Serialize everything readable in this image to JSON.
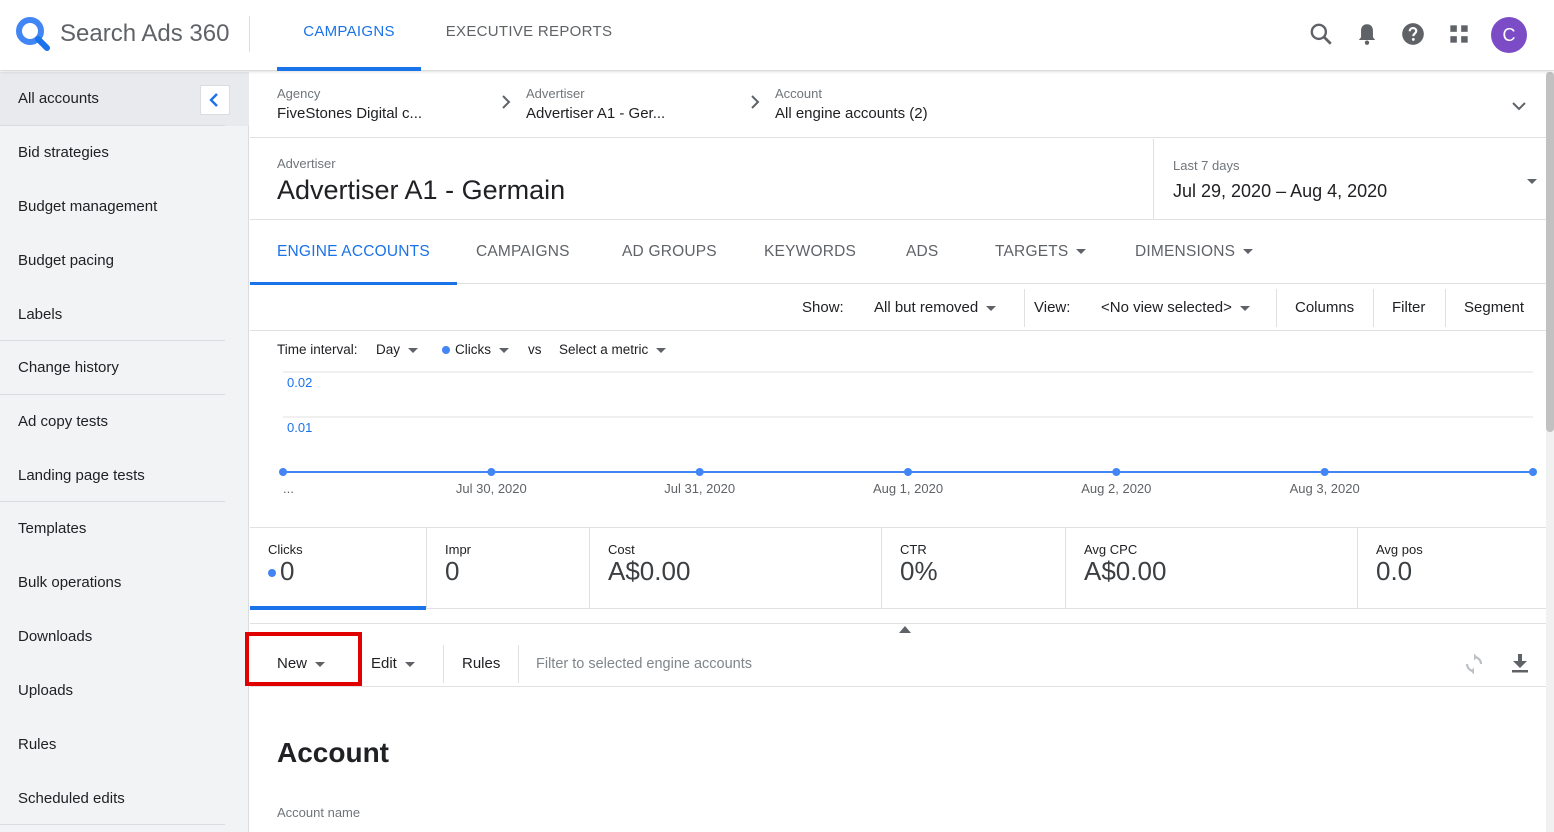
{
  "app": {
    "name": "Search Ads 360",
    "avatar_letter": "C"
  },
  "top_tabs": [
    {
      "label": "CAMPAIGNS",
      "active": true
    },
    {
      "label": "EXECUTIVE REPORTS",
      "active": false
    }
  ],
  "top_icons": [
    "search-icon",
    "notifications-icon",
    "help-icon",
    "apps-icon"
  ],
  "sidebar": {
    "items": [
      {
        "label": "All accounts"
      },
      {
        "label": "Bid strategies"
      },
      {
        "label": "Budget management"
      },
      {
        "label": "Budget pacing"
      },
      {
        "label": "Labels"
      },
      {
        "label": "Change history"
      },
      {
        "label": "Ad copy tests"
      },
      {
        "label": "Landing page tests"
      },
      {
        "label": "Templates"
      },
      {
        "label": "Bulk operations"
      },
      {
        "label": "Downloads"
      },
      {
        "label": "Uploads"
      },
      {
        "label": "Rules"
      },
      {
        "label": "Scheduled edits"
      }
    ]
  },
  "breadcrumb": [
    {
      "label": "Agency",
      "value": "FiveStones Digital c..."
    },
    {
      "label": "Advertiser",
      "value": "Advertiser A1 - Ger..."
    },
    {
      "label": "Account",
      "value": "All engine accounts (2)"
    }
  ],
  "header": {
    "label": "Advertiser",
    "title": "Advertiser A1 - Germain",
    "date_label": "Last 7 days",
    "date_range": "Jul 29, 2020 – Aug 4, 2020"
  },
  "entity_tabs": [
    {
      "label": "ENGINE ACCOUNTS",
      "active": true
    },
    {
      "label": "CAMPAIGNS"
    },
    {
      "label": "AD GROUPS"
    },
    {
      "label": "KEYWORDS"
    },
    {
      "label": "ADS"
    },
    {
      "label": "TARGETS"
    },
    {
      "label": "DIMENSIONS"
    }
  ],
  "toolbar": {
    "show_label": "Show:",
    "show_value": "All but removed",
    "view_label": "View:",
    "view_value": "<No view selected>",
    "columns": "Columns",
    "filter": "Filter",
    "segment": "Segment"
  },
  "chart_controls": {
    "interval_label": "Time interval:",
    "interval_value": "Day",
    "metric": "Clicks",
    "vs": "vs",
    "compare": "Select a metric"
  },
  "chart_data": {
    "type": "line",
    "x": [
      "...",
      "Jul 30, 2020",
      "Jul 31, 2020",
      "Aug 1, 2020",
      "Aug 2, 2020",
      "Aug 3, 2020",
      ""
    ],
    "series": [
      {
        "name": "Clicks",
        "values": [
          0,
          0,
          0,
          0,
          0,
          0,
          0
        ],
        "color": "#4285f4"
      }
    ],
    "ylim": [
      0,
      0.02
    ],
    "yticks": [
      "0.02",
      "0.01"
    ],
    "grid": true
  },
  "metrics": [
    {
      "label": "Clicks",
      "value": "0"
    },
    {
      "label": "Impr",
      "value": "0"
    },
    {
      "label": "Cost",
      "value": "A$0.00"
    },
    {
      "label": "CTR",
      "value": "0%"
    },
    {
      "label": "Avg CPC",
      "value": "A$0.00"
    },
    {
      "label": "Avg pos",
      "value": "0.0"
    }
  ],
  "actions": {
    "new": "New",
    "edit": "Edit",
    "rules": "Rules",
    "filter_placeholder": "Filter to selected engine accounts"
  },
  "form": {
    "title": "Account",
    "account_name_label": "Account name"
  },
  "colors": {
    "accent": "#1a73e8",
    "avatar": "#7b4cc6",
    "highlight": "#e00000"
  }
}
